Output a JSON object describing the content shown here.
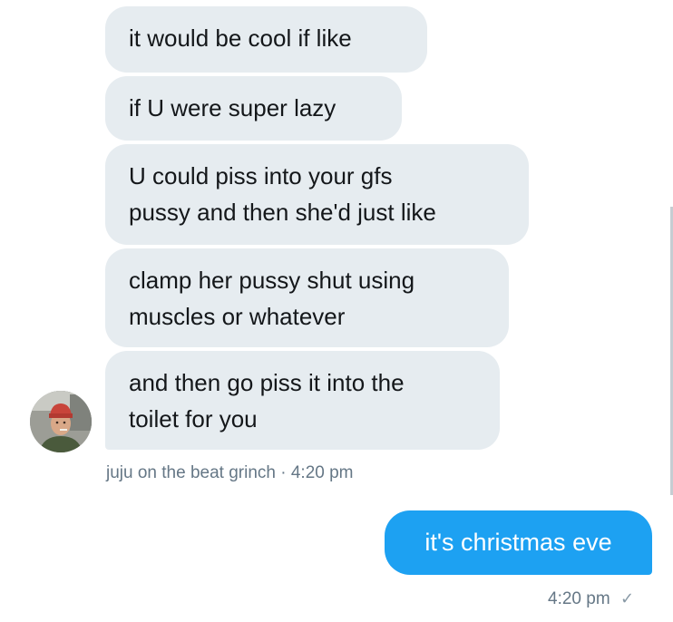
{
  "received_messages": [
    {
      "lines": [
        "it would be cool if like"
      ]
    },
    {
      "lines": [
        "if U were super lazy"
      ]
    },
    {
      "lines": [
        "U could piss into your gfs",
        "pussy and then she'd just like"
      ]
    },
    {
      "lines": [
        "clamp her pussy shut using",
        "muscles or whatever"
      ]
    },
    {
      "lines": [
        "and then go piss it into the",
        "toilet for you"
      ]
    }
  ],
  "received_meta": {
    "sender": "juju on the beat grinch",
    "separator": " · ",
    "time": "4:20 pm"
  },
  "sent_message": {
    "text": "it's christmas eve",
    "time": "4:20 pm",
    "status_icon": "checkmark-icon"
  },
  "colors": {
    "received_bubble": "#e6ecf0",
    "sent_bubble": "#1da1f2",
    "meta_text": "#657786"
  }
}
